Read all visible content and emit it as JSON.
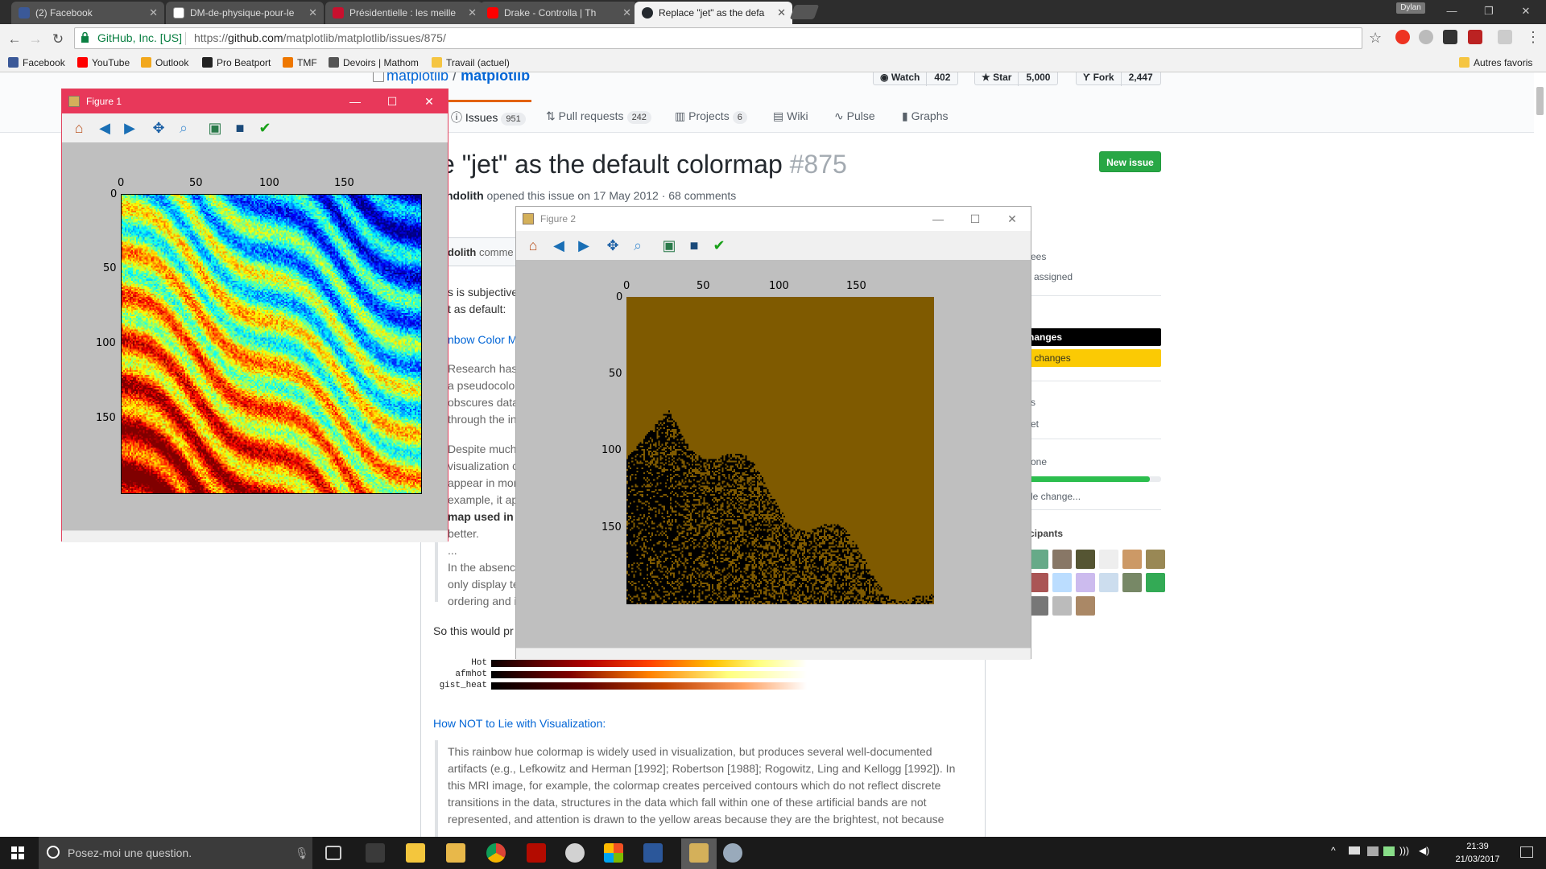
{
  "browser": {
    "tabs": [
      {
        "title": "(2) Facebook",
        "color": "#3b5998",
        "active": false
      },
      {
        "title": "DM-de-physique-pour-le",
        "color": "#888888",
        "active": false
      },
      {
        "title": "Présidentielle : les meille",
        "color": "#c8102e",
        "active": false
      },
      {
        "title": "Drake - Controlla | Th",
        "color": "#ff0000",
        "active": false
      },
      {
        "title": "Replace \"jet\" as the defa",
        "color": "#24292e",
        "active": true
      }
    ],
    "profile_name": "Dylan",
    "secure_label": "GitHub, Inc. [US]",
    "url_scheme": "https://",
    "url_host": "github.com",
    "url_path": "/matplotlib/matplotlib/issues/875/",
    "bookmarks": [
      {
        "label": "Facebook",
        "color": "#3b5998"
      },
      {
        "label": "YouTube",
        "color": "#ff0000"
      },
      {
        "label": "Outlook",
        "color": "#f2a81d"
      },
      {
        "label": "Pro Beatport",
        "color": "#222222"
      },
      {
        "label": "TMF",
        "color": "#ee7700"
      },
      {
        "label": "Devoirs | Mathom",
        "color": "#555555"
      },
      {
        "label": "Travail (actuel)",
        "color": "#f5c542"
      }
    ],
    "other_bookmarks": "Autres favoris"
  },
  "github": {
    "owner": "matplotlib",
    "separator": "/",
    "repo": "matplotlib",
    "watch_label": "Watch",
    "watch_count": "402",
    "star_label": "Star",
    "star_count": "5,000",
    "fork_label": "Fork",
    "fork_count": "2,447",
    "tabs": [
      {
        "label": "Issues",
        "count": "951"
      },
      {
        "label": "Pull requests",
        "count": "242"
      },
      {
        "label": "Projects",
        "count": "6"
      },
      {
        "label": "Wiki",
        "count": ""
      },
      {
        "label": "Pulse",
        "count": ""
      },
      {
        "label": "Graphs",
        "count": ""
      }
    ],
    "issue_title": "e \"jet\" as the default colormap",
    "issue_number": "#875",
    "new_issue": "New issue",
    "author": "ndolith",
    "meta_text": "opened this issue on 17 May 2012 · 68 comments",
    "comment_author": "dolith",
    "comment_action": "comme",
    "body": [
      "s is subjective",
      "t  as default:",
      "nbow Color M",
      "Research has s",
      "a pseudocolor",
      "obscures data",
      "through the in",
      "Despite much",
      "visualization c",
      "appear in mor",
      "example, it ap",
      "map used in r",
      "better.",
      "...",
      "In the absence",
      "only display te",
      "ordering and i",
      "So this would pr"
    ],
    "colorbars": [
      "Hot",
      "afmhot",
      "gist_heat"
    ],
    "link2": "How NOT to Lie with Visualization:",
    "quote2": [
      "This rainbow hue colormap is widely used in visualization, but produces several well-documented",
      "artifacts (e.g., Lefkowitz and Herman [1992]; Robertson [1988]; Rogowitz, Ling and Kellogg [1992]). In",
      "this MRI image, for example, the colormap creates perceived contours which do not reflect discrete",
      "transitions in the data, structures in the data which fall within one of these artificial bands are not",
      "represented, and attention is drawn to the yellow areas because they are the brightest, not because"
    ],
    "sidebar": {
      "assignees_fragment": "ees",
      "assigned_fragment": "assigned",
      "label_black": "hanges",
      "label_yellow": "lt changes",
      "projects_fragment": "s",
      "projects_value": "et",
      "milestone_fragment": "one",
      "milestone_progress": 0.93,
      "milestone_link": "le change...",
      "participants_fragment": "cipants"
    }
  },
  "figure1": {
    "title": "Figure 1",
    "xticks": [
      "0",
      "50",
      "100",
      "150"
    ],
    "yticks": [
      "0",
      "50",
      "100",
      "150"
    ],
    "colormap": "jet"
  },
  "figure2": {
    "title": "Figure 2",
    "xticks": [
      "0",
      "50",
      "100",
      "150"
    ],
    "yticks": [
      "0",
      "50",
      "100",
      "150"
    ],
    "background_color": "#7f5a00"
  },
  "taskbar": {
    "search_placeholder": "Posez-moi une question.",
    "time": "21:39",
    "date": "21/03/2017"
  }
}
